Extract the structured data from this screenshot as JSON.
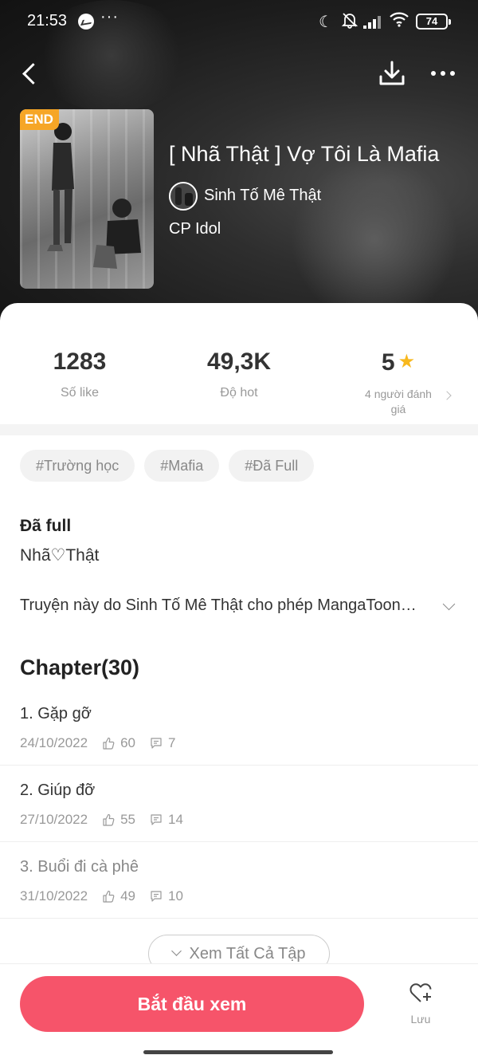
{
  "status_bar": {
    "time": "21:53",
    "dots": "···",
    "battery": "74",
    "icons": [
      "messenger-icon",
      "moon-icon",
      "bell-off-icon",
      "signal-icon",
      "wifi-icon",
      "battery-icon"
    ]
  },
  "header": {
    "back_icon": "chevron-left-icon",
    "download_icon": "download-icon",
    "more_icon": "more-dots-icon"
  },
  "comic": {
    "badge": "END",
    "title": "[ Nhã Thật ] Vợ Tôi Là Mafia",
    "author": "Sinh Tố Mê Thật",
    "category": "CP Idol"
  },
  "stats": {
    "likes_value": "1283",
    "likes_label": "Số like",
    "hot_value": "49,3K",
    "hot_label": "Độ hot",
    "rating_value": "5",
    "rating_label": "4 người đánh giá"
  },
  "tags": [
    "#Trường học",
    "#Mafia",
    "#Đã Full"
  ],
  "info": {
    "status": "Đã full",
    "pen_name": "Nhã♡Thật",
    "description": "Truyện này do Sinh Tố Mê Thật cho phép MangaToon…"
  },
  "chapters": {
    "heading": "Chapter(30)",
    "items": [
      {
        "title": "1. Gặp gỡ",
        "date": "24/10/2022",
        "likes": "60",
        "comments": "7"
      },
      {
        "title": "2. Giúp đỡ",
        "date": "27/10/2022",
        "likes": "55",
        "comments": "14"
      },
      {
        "title": "3. Buổi đi cà phê",
        "date": "31/10/2022",
        "likes": "49",
        "comments": "10"
      }
    ],
    "view_all": "Xem Tất Cả Tập"
  },
  "bottom": {
    "start_label": "Bắt đầu xem",
    "save_label": "Lưu"
  },
  "colors": {
    "primary": "#f6546a",
    "badge": "#f6a626",
    "star": "#f8b81e"
  }
}
